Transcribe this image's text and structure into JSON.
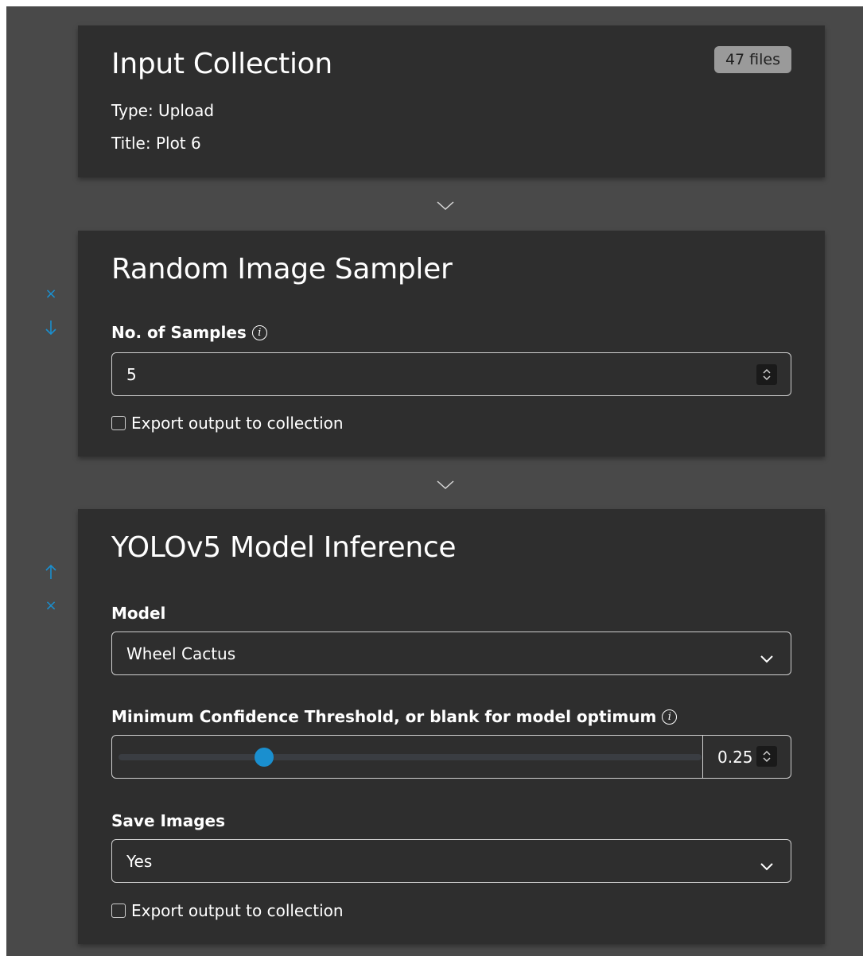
{
  "input_collection": {
    "title": "Input Collection",
    "badge": "47 files",
    "type_line": "Type: Upload",
    "title_line": "Title: Plot 6"
  },
  "sampler": {
    "title": "Random Image Sampler",
    "samples_label": "No. of Samples",
    "samples_value": "5",
    "export_label": "Export output to collection",
    "side_icons": [
      "close-icon",
      "arrow-down-icon"
    ]
  },
  "inference": {
    "title": "YOLOv5 Model Inference",
    "model_label": "Model",
    "model_value": "Wheel Cactus",
    "threshold_label": "Minimum Confidence Threshold, or blank for model optimum",
    "threshold_value": "0.25",
    "threshold_fraction": 0.25,
    "save_label": "Save Images",
    "save_value": "Yes",
    "export_label": "Export output to collection",
    "side_icons": [
      "arrow-up-icon",
      "close-icon"
    ]
  },
  "colors": {
    "page_bg": "#494949",
    "card_bg": "#2e2e2e",
    "accent": "#1a8fcf",
    "badge_bg": "#9a9a9a"
  }
}
